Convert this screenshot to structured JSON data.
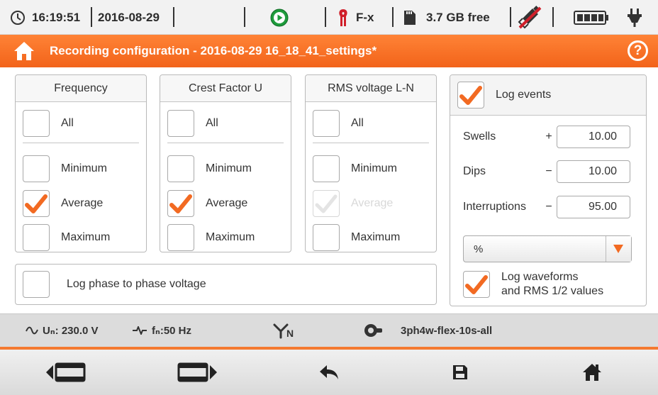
{
  "status": {
    "time": "16:19:51",
    "date": "2016-08-29",
    "clamp_label": "F-x",
    "storage": "3.7 GB free",
    "icons": [
      "clock-icon",
      "play-icon",
      "clamp-icon",
      "sd-card-icon",
      "usb-disconnected-icon",
      "battery-icon",
      "power-plug-icon"
    ]
  },
  "title": {
    "text": "Recording configuration - 2016-08-29 16_18_41_settings*",
    "help": "?"
  },
  "groups": [
    {
      "title": "Frequency",
      "all_label": "All",
      "items": [
        {
          "label": "Minimum",
          "checked": false,
          "disabled": false
        },
        {
          "label": "Average",
          "checked": true,
          "disabled": false
        },
        {
          "label": "Maximum",
          "checked": false,
          "disabled": false
        }
      ]
    },
    {
      "title": "Crest Factor U",
      "all_label": "All",
      "items": [
        {
          "label": "Minimum",
          "checked": false,
          "disabled": false
        },
        {
          "label": "Average",
          "checked": true,
          "disabled": false
        },
        {
          "label": "Maximum",
          "checked": false,
          "disabled": false
        }
      ]
    },
    {
      "title": "RMS voltage L-N",
      "all_label": "All",
      "items": [
        {
          "label": "Minimum",
          "checked": false,
          "disabled": false
        },
        {
          "label": "Average",
          "checked": true,
          "disabled": true
        },
        {
          "label": "Maximum",
          "checked": false,
          "disabled": false
        }
      ]
    }
  ],
  "phase_to_phase": {
    "label": "Log phase to phase voltage",
    "checked": false
  },
  "events": {
    "log_label": "Log events",
    "checked": true,
    "swells": {
      "label": "Swells",
      "sign": "+",
      "value": "10.00"
    },
    "dips": {
      "label": "Dips",
      "sign": "−",
      "value": "10.00"
    },
    "interruptions": {
      "label": "Interruptions",
      "sign": "−",
      "value": "95.00"
    },
    "unit": "%",
    "waveforms_line1": "Log waveforms",
    "waveforms_line2": "and RMS 1/2 values",
    "waveforms_checked": true
  },
  "info": {
    "voltage": "Uₙ: 230.0 V",
    "frequency": "fₙ:50 Hz",
    "network_symbol": "N",
    "profile": "3ph4w-flex-10s-all"
  },
  "colors": {
    "accent": "#f26a22",
    "check": "#f26a22"
  }
}
